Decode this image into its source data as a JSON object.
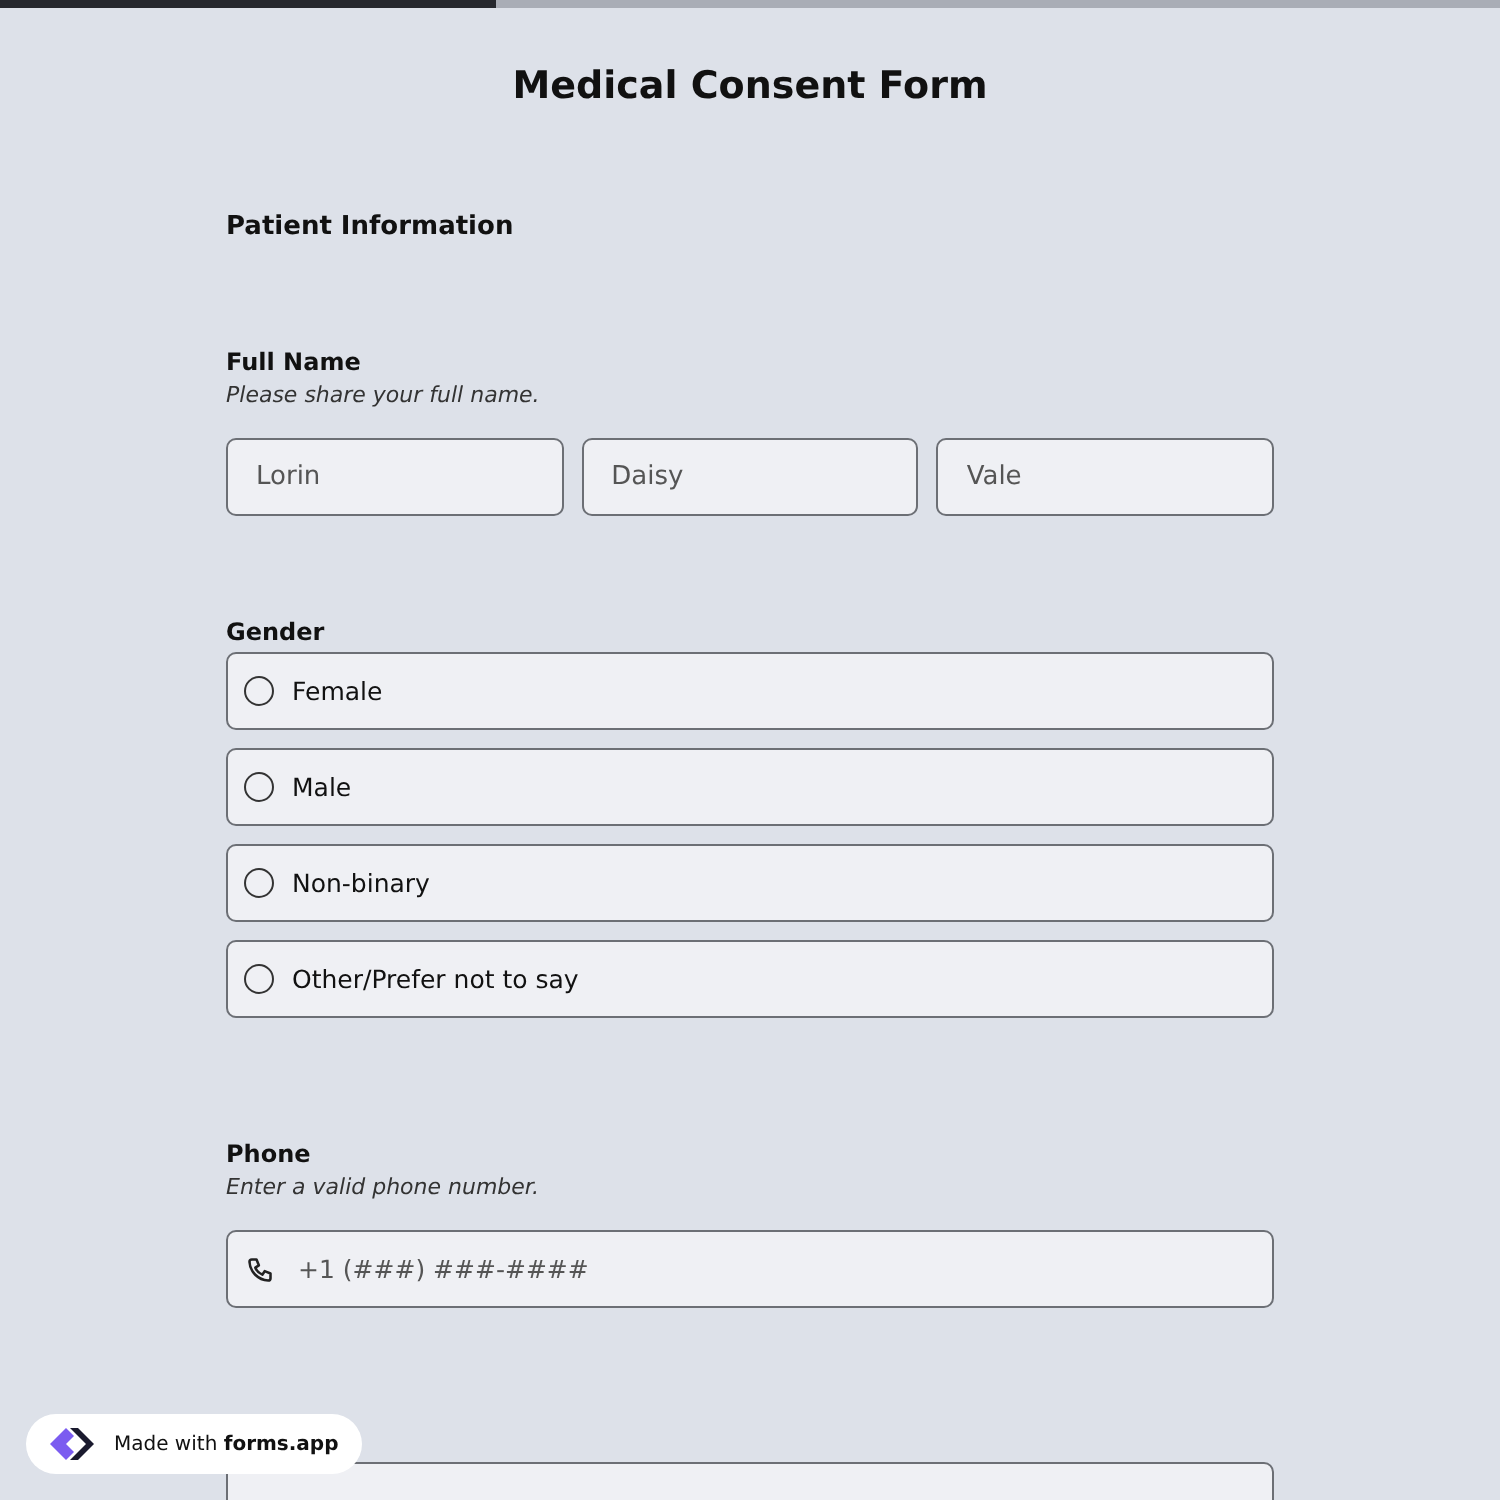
{
  "progress": {
    "level": 0.33
  },
  "title": "Medical Consent Form",
  "section": "Patient Information",
  "full_name": {
    "label": "Full Name",
    "hint": "Please share your full name.",
    "fields": [
      {
        "placeholder": "Lorin"
      },
      {
        "placeholder": "Daisy"
      },
      {
        "placeholder": "Vale"
      }
    ]
  },
  "gender": {
    "label": "Gender",
    "options": [
      {
        "label": "Female",
        "selected": false
      },
      {
        "label": "Male",
        "selected": false
      },
      {
        "label": "Non-binary",
        "selected": false
      },
      {
        "label": "Other/Prefer not to say",
        "selected": false
      }
    ]
  },
  "phone": {
    "label": "Phone",
    "hint": "Enter a valid phone number.",
    "placeholder": "+1 (###) ###-####"
  },
  "badge": {
    "text": "Made with **forms.app**"
  }
}
